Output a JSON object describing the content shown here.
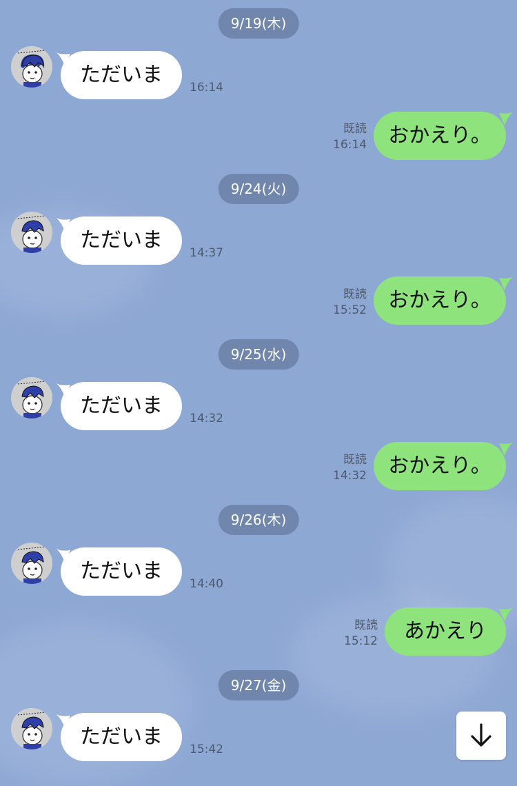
{
  "days": [
    {
      "date": "9/19(木)",
      "incoming": {
        "text": "ただいま",
        "time": "16:14"
      },
      "outgoing": {
        "text": "おかえり。",
        "read": "既読",
        "time": "16:14"
      }
    },
    {
      "date": "9/24(火)",
      "incoming": {
        "text": "ただいま",
        "time": "14:37"
      },
      "outgoing": {
        "text": "おかえり。",
        "read": "既読",
        "time": "15:52"
      }
    },
    {
      "date": "9/25(水)",
      "incoming": {
        "text": "ただいま",
        "time": "14:32"
      },
      "outgoing": {
        "text": "おかえり。",
        "read": "既読",
        "time": "14:32"
      }
    },
    {
      "date": "9/26(木)",
      "incoming": {
        "text": "ただいま",
        "time": "14:40"
      },
      "outgoing": {
        "text": "あかえり",
        "read": "既読",
        "time": "15:12"
      }
    },
    {
      "date": "9/27(金)",
      "incoming": {
        "text": "ただいま",
        "time": "15:42"
      }
    }
  ],
  "avatar_icon": "cartoon-character-avatar",
  "scroll_button_icon": "arrow-down-icon",
  "colors": {
    "background": "#8ea8d4",
    "date_pill": "#7186ad",
    "incoming_bubble": "#ffffff",
    "outgoing_bubble": "#8ee37c",
    "meta_text": "#4e5a70"
  }
}
